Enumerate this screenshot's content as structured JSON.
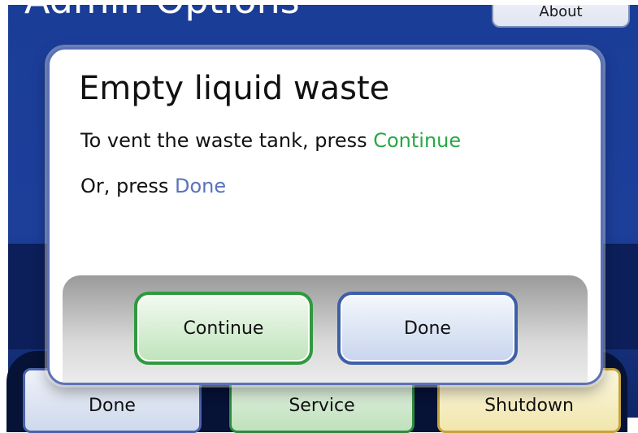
{
  "background": {
    "title": "Admin Options",
    "about_button": "About",
    "bottom_buttons": {
      "done": "Done",
      "service": "Service",
      "shutdown": "Shutdown"
    }
  },
  "dialog": {
    "title": "Empty liquid waste",
    "line1_prefix": "To vent the waste tank, press ",
    "line1_action": "Continue",
    "line2_prefix": "Or, press ",
    "line2_action": "Done",
    "buttons": {
      "continue": "Continue",
      "done": "Done"
    }
  },
  "colors": {
    "background_blue": "#1d3f9a",
    "continue_green": "#28a745",
    "done_blue": "#5a73bf",
    "dialog_border": "#5c72b5"
  }
}
